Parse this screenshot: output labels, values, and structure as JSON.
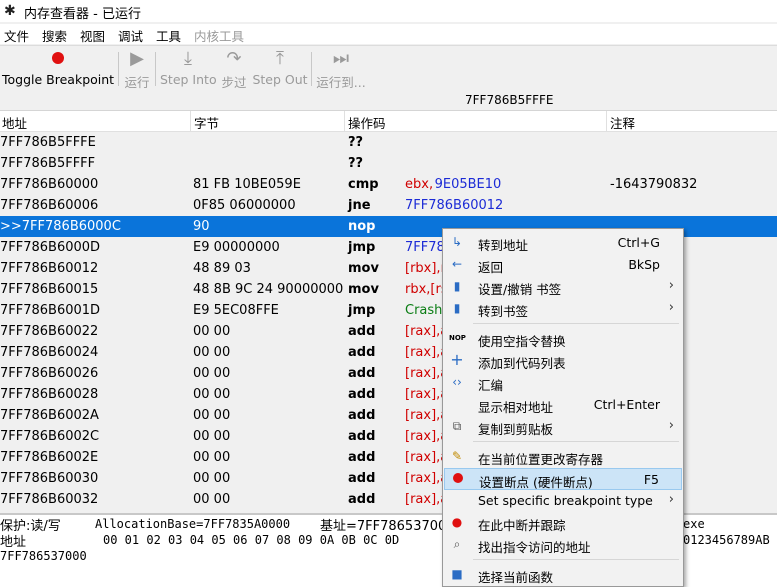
{
  "window": {
    "title": "内存查看器 - 已运行"
  },
  "menu": {
    "file": "文件",
    "search": "搜索",
    "view": "视图",
    "debug": "调试",
    "tools": "工具",
    "kernel": "内核工具"
  },
  "toolbar": {
    "toggle_bp": "Toggle Breakpoint",
    "run": "运行",
    "step_into": "Step Into",
    "step_over": "步过",
    "step_out": "Step Out",
    "run_to": "运行到..."
  },
  "address_bar": "7FF786B5FFFE",
  "columns": {
    "address": "地址",
    "bytes": "字节",
    "opcode": "操作码",
    "comment": "注释"
  },
  "rows": [
    {
      "addr": "7FF786B5FFFE",
      "bytes": "",
      "op": "??",
      "arg1": "",
      "arg2": "",
      "comment": ""
    },
    {
      "addr": "7FF786B5FFFF",
      "bytes": "",
      "op": "??",
      "arg1": "",
      "arg2": "",
      "comment": ""
    },
    {
      "addr": "7FF786B60000",
      "bytes": "81 FB 10BE059E",
      "op": "cmp",
      "arg1": "ebx,",
      "arg2": "9E05BE10",
      "comment": "-1643790832"
    },
    {
      "addr": "7FF786B60006",
      "bytes": "0F85 06000000",
      "op": "jne",
      "arg1": "",
      "arg2": "7FF786B60012",
      "comment": ""
    },
    {
      "addr": ">>7FF786B6000C",
      "bytes": "90",
      "op": "nop",
      "arg1": "",
      "arg2": "",
      "comment": ""
    },
    {
      "addr": "7FF786B6000D",
      "bytes": "E9 00000000",
      "op": "jmp",
      "arg1": "",
      "arg2": "7FF78",
      "comment": ""
    },
    {
      "addr": "7FF786B60012",
      "bytes": "48 89 03",
      "op": "mov",
      "arg1": "[rbx],r",
      "arg2": "",
      "comment": ""
    },
    {
      "addr": "7FF786B60015",
      "bytes": "48 8B 9C 24 90000000",
      "op": "mov",
      "arg1": "rbx,[rs",
      "arg2": "",
      "comment": ""
    },
    {
      "addr": "7FF786B6001D",
      "bytes": "E9 5EC08FFE",
      "op": "jmp",
      "arg1": "Crashl",
      "arg2": "",
      "comment": ""
    },
    {
      "addr": "7FF786B60022",
      "bytes": "00 00",
      "op": "add",
      "arg1": "[rax],a",
      "arg2": "",
      "comment": ""
    },
    {
      "addr": "7FF786B60024",
      "bytes": "00 00",
      "op": "add",
      "arg1": "[rax],a",
      "arg2": "",
      "comment": ""
    },
    {
      "addr": "7FF786B60026",
      "bytes": "00 00",
      "op": "add",
      "arg1": "[rax],a",
      "arg2": "",
      "comment": ""
    },
    {
      "addr": "7FF786B60028",
      "bytes": "00 00",
      "op": "add",
      "arg1": "[rax],a",
      "arg2": "",
      "comment": ""
    },
    {
      "addr": "7FF786B6002A",
      "bytes": "00 00",
      "op": "add",
      "arg1": "[rax],a",
      "arg2": "",
      "comment": ""
    },
    {
      "addr": "7FF786B6002C",
      "bytes": "00 00",
      "op": "add",
      "arg1": "[rax],a",
      "arg2": "",
      "comment": ""
    },
    {
      "addr": "7FF786B6002E",
      "bytes": "00 00",
      "op": "add",
      "arg1": "[rax],a",
      "arg2": "",
      "comment": ""
    },
    {
      "addr": "7FF786B60030",
      "bytes": "00 00",
      "op": "add",
      "arg1": "[rax],a",
      "arg2": "",
      "comment": ""
    },
    {
      "addr": "7FF786B60032",
      "bytes": "00 00",
      "op": "add",
      "arg1": "[rax],a",
      "arg2": "",
      "comment": ""
    }
  ],
  "bottom": {
    "protect": "保护:读/写",
    "alloc": "AllocationBase=7FF7835A0000",
    "base": "基址=7FF78653700",
    "exe": "exe",
    "addr_label": "地址",
    "hex_header": "00 01 02 03 04 05 06 07 08 09 0A 0B 0C 0D",
    "ascii_header": "0123456789AB",
    "first_addr": "7FF786537000"
  },
  "context_menu": {
    "goto_addr": "转到地址",
    "goto_addr_sc": "Ctrl+G",
    "back": "返回",
    "back_sc": "BkSp",
    "bookmark": "设置/撤销 书签",
    "goto_bookmark": "转到书签",
    "replace_nop": "使用空指令替换",
    "add_codelist": "添加到代码列表",
    "assemble": "汇编",
    "show_relative": "显示相对地址",
    "show_relative_sc": "Ctrl+Enter",
    "copy_clipboard": "复制到剪贴板",
    "change_reg": "在当前位置更改寄存器",
    "set_bp": "设置断点 (硬件断点)",
    "set_bp_sc": "F5",
    "set_specific_bp": "Set specific breakpoint type",
    "break_trace": "在此中断并跟踪",
    "find_access": "找出指令访问的地址",
    "select_func": "选择当前函数"
  },
  "colors": {
    "selection": "#0a74da",
    "menu_highlight": "#cce4f7",
    "register": "#d00000",
    "address": "#1c2bd6"
  }
}
